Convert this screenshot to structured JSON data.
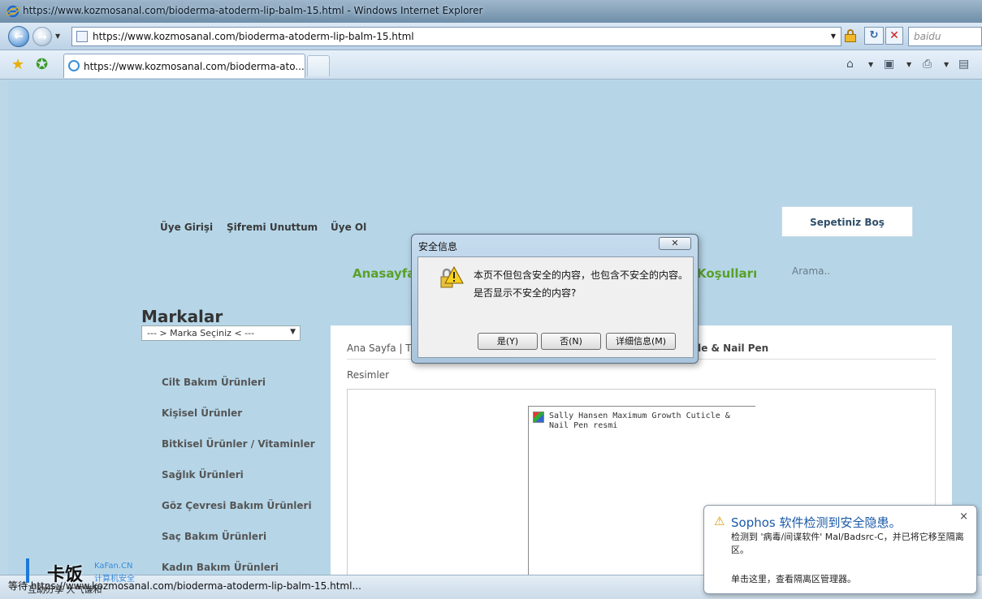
{
  "window": {
    "title": "https://www.kozmosanal.com/bioderma-atoderm-lip-balm-15.html - Windows Internet Explorer"
  },
  "address_bar": {
    "url": "https://www.kozmosanal.com/bioderma-atoderm-lip-balm-15.html",
    "search_placeholder": "baidu"
  },
  "tab": {
    "label": "https://www.kozmosanal.com/bioderma-ato..."
  },
  "site": {
    "top_links": [
      "Üye Girişi",
      "Şifremi Unuttum",
      "Üye Ol"
    ],
    "cart_label": "Sepetiniz Boş",
    "main_nav": [
      "Anasayfa",
      "Koşulları"
    ],
    "search_placeholder": "Arama..",
    "brands_heading": "Markalar",
    "brand_select": "--- > Marka Seçiniz < ---",
    "categories": [
      "Cilt Bakım Ürünleri",
      "Kişisel Ürünler",
      "Bitkisel Ürünler / Vitaminler",
      "Sağlık Ürünleri",
      "Göz Çevresi Bakım Ürünleri",
      "Saç Bakım Ürünleri",
      "Kadın Bakım Ürünleri"
    ],
    "breadcrumb_start": "Ana Sayfa | T",
    "breadcrumb_end": "cle & Nail Pen",
    "images_label": "Resimler",
    "broken_image_alt": "Sally Hansen Maximum Growth Cuticle & Nail Pen resmi"
  },
  "dialog": {
    "title": "安全信息",
    "message_line1": "本页不但包含安全的内容，也包含不安全的内容。",
    "message_line2": "是否显示不安全的内容?",
    "yes_label": "是(Y)",
    "no_label": "否(N)",
    "details_label": "详细信息(M)"
  },
  "status_bar": {
    "text": "等待 https://www.kozmosanal.com/bioderma-atoderm-lip-balm-15.html..."
  },
  "watermark": {
    "brand": "卡饭",
    "english": "KaFan.CN",
    "chinese": "计算机安全",
    "slogan": "互助分享  大气谦和"
  },
  "toast": {
    "title": "Sophos 软件检测到安全隐患。",
    "body": "检测到 '病毒/间谍软件' Mal/Badsrc-C，并已将它移至隔离区。",
    "link": "单击这里，查看隔离区管理器。",
    "close": "×"
  },
  "colors": {
    "page_bg": "#b6d6e8",
    "nav_green": "#5aa02a",
    "toast_title": "#1a5aa8"
  }
}
